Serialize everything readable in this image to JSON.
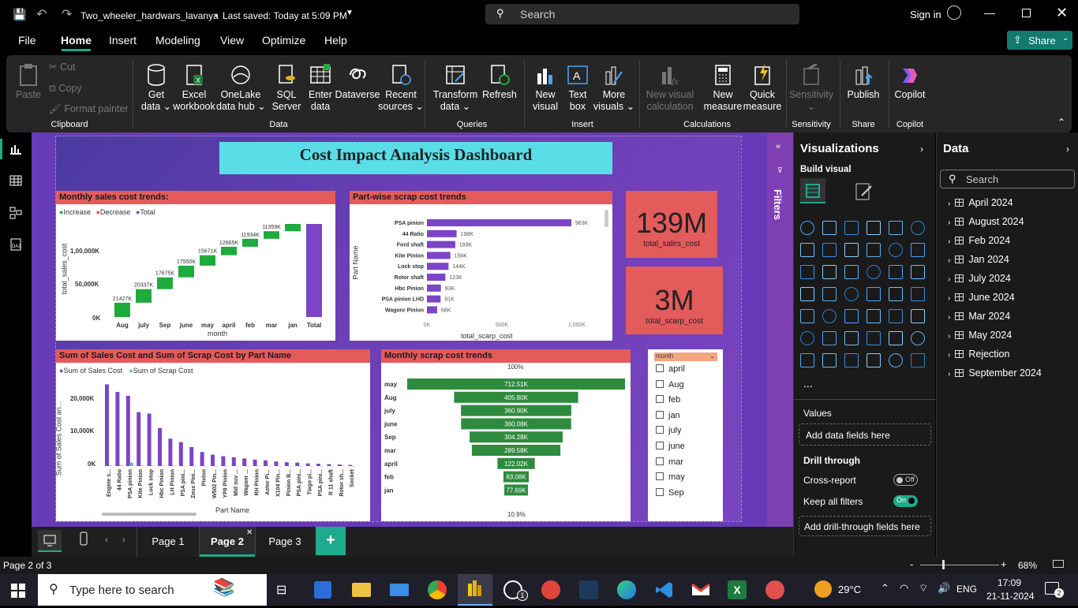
{
  "titlebar": {
    "filename": "Two_wheeler_hardwars_lavanya",
    "saved": "Last saved: Today at 5:09 PM",
    "search": "Search",
    "signin": "Sign in"
  },
  "menu": {
    "items": [
      "File",
      "Home",
      "Insert",
      "Modeling",
      "View",
      "Optimize",
      "Help"
    ],
    "active": "Home",
    "share": "Share"
  },
  "ribbon": {
    "clipboard": {
      "paste": "Paste",
      "cut": "Cut",
      "copy": "Copy",
      "format_painter": "Format painter",
      "group": "Clipboard"
    },
    "data": {
      "items": [
        "Get\ndata ⌄",
        "Excel\nworkbook",
        "OneLake\ndata hub ⌄",
        "SQL\nServer",
        "Enter\ndata",
        "Dataverse",
        "Recent\nsources ⌄"
      ],
      "group": "Data"
    },
    "queries": {
      "items": [
        "Transform\ndata ⌄",
        "Refresh"
      ],
      "group": "Queries"
    },
    "insert": {
      "items": [
        "New\nvisual",
        "Text\nbox",
        "More\nvisuals ⌄"
      ],
      "group": "Insert"
    },
    "calculations": {
      "items": [
        "New visual\ncalculation",
        "New\nmeasure",
        "Quick\nmeasure"
      ],
      "group": "Calculations"
    },
    "sensitivity": {
      "items": [
        "Sensitivity\n⌄"
      ],
      "group": "Sensitivity"
    },
    "share": {
      "items": [
        "Publish"
      ],
      "group": "Share"
    },
    "copilot": {
      "items": [
        "Copilot"
      ],
      "group": "Copilot"
    }
  },
  "report": {
    "title": "Cost Impact Analysis Dashboard"
  },
  "waterfall": {
    "title": "Monthly sales cost trends:",
    "legend": [
      "Increase",
      "Decrease",
      "Total"
    ],
    "ylabel": "total_sales_cost",
    "xlabel": "month",
    "yticks": [
      "0K",
      "50,000K",
      "1,00,000K"
    ],
    "colors": {
      "increase": "#1eaa3c",
      "decrease": "#e35b5b",
      "total": "#7b45c6"
    }
  },
  "scrapbars": {
    "title": "Part-wise scrap cost trends",
    "ylabel": "Part Name",
    "xlabel": "total_scarp_cost",
    "xticks": [
      "0K",
      "500K",
      "1,000K"
    ],
    "color": "#7b45c6"
  },
  "kpi": {
    "sales_value": "139M",
    "sales_label": "total_sales_cost",
    "scrap_value": "3M",
    "scrap_label": "total_scarp_cost",
    "color": "#e35b5b"
  },
  "clustered": {
    "title": "Sum of Sales Cost and Sum of Scrap Cost by Part Name",
    "legend": [
      "Sum of Sales Cost",
      "Sum of Scrap Cost"
    ],
    "ylabel": "Sum of Sales Cost an...",
    "xlabel": "Part Name",
    "yticks": [
      "0K",
      "10,000K",
      "20,000K"
    ],
    "colors": {
      "sales": "#7b45c6",
      "scrap": "#5bc0de"
    }
  },
  "funnel": {
    "title": "Monthly scrap cost trends",
    "top_pct": "100%",
    "bottom_pct": "10.9%",
    "color": "#2e8b3e"
  },
  "slicer": {
    "title": "month",
    "items": [
      "april",
      "Aug",
      "feb",
      "jan",
      "july",
      "june",
      "mar",
      "may",
      "Sep"
    ]
  },
  "filters": {
    "label": "Filters"
  },
  "viz": {
    "title": "Visualizations",
    "build": "Build visual",
    "values": "Values",
    "add_data": "Add data fields here",
    "drill": "Drill through",
    "cross": "Cross-report",
    "cross_state": "Off",
    "keep": "Keep all filters",
    "keep_state": "On",
    "add_drill": "Add drill-through fields here",
    "more": "..."
  },
  "data": {
    "title": "Data",
    "search": "Search",
    "tables": [
      "April 2024",
      "August 2024",
      "Feb 2024",
      "Jan 2024",
      "July 2024",
      "June 2024",
      "Mar 2024",
      "May 2024",
      "Rejection",
      "September 2024"
    ]
  },
  "pages": {
    "tabs": [
      "Page 1",
      "Page 2",
      "Page 3"
    ],
    "active": "Page 2",
    "add": "+"
  },
  "status": {
    "page": "Page 2 of 3",
    "zoom": "68%"
  },
  "taskbar": {
    "search": "Type here to search",
    "temp": "29°C",
    "lang": "ENG",
    "time": "17:09",
    "date": "21-11-2024",
    "notif": "2",
    "badge": "1"
  },
  "chart_data": [
    {
      "type": "waterfall",
      "title": "Monthly sales cost trends:",
      "xlabel": "month",
      "ylabel": "total_sales_cost",
      "categories": [
        "Aug",
        "july",
        "Sep",
        "june",
        "may",
        "april",
        "feb",
        "mar",
        "jan",
        "Total"
      ],
      "values": [
        21427,
        20337,
        17675,
        17550,
        15671,
        12665,
        11934,
        11359,
        10866,
        139484
      ],
      "labels": [
        "21427K",
        "20337K",
        "17675K",
        "17550K",
        "15671K",
        "12665K",
        "11934K",
        "11359K",
        "",
        ""
      ]
    },
    {
      "type": "bar",
      "orientation": "horizontal",
      "title": "Part-wise scrap cost trends",
      "xlabel": "total_scarp_cost",
      "ylabel": "Part Name",
      "categories": [
        "PSA pinion",
        "44 Ratio",
        "Ford shaft",
        "Kite Pinion",
        "Lock stop",
        "Rotor shaft",
        "Hbc Pinion",
        "PSA pinion LHD",
        "Wagonr Pinion"
      ],
      "values": [
        963,
        198,
        189,
        156,
        144,
        123,
        93,
        91,
        68
      ],
      "labels": [
        "963K",
        "198K",
        "189K",
        "156K",
        "144K",
        "123K",
        "93K",
        "91K",
        "68K"
      ],
      "xlim": [
        0,
        1000
      ]
    },
    {
      "type": "bar",
      "title": "Sum of Sales Cost and Sum of Scrap Cost by Part Name",
      "xlabel": "Part Name",
      "ylabel": "Sum of Sales Cost an...",
      "categories": [
        "Engine s...",
        "44 Ratio",
        "PSA pinion",
        "Kite Pinion",
        "Lock stop",
        "Hbc Pinion",
        "LH Pinion",
        "PSA pini...",
        "Zeus Pini...",
        "Piston",
        "W502 Pin...",
        "YP8 Pinion",
        "Mid suv ...",
        "Wagonr ...",
        "RH Pinion",
        "Astor Pi...",
        "X104 Pin...",
        "Pinion B...",
        "PSA pini...",
        "Tiago pi...",
        "PSA pini...",
        "R 11 shaft",
        "Rotor sh...",
        "Socket"
      ],
      "series": [
        {
          "name": "Sum of Sales Cost",
          "values": [
            21500,
            19500,
            18500,
            14200,
            13800,
            10000,
            7200,
            6300,
            5000,
            3700,
            3000,
            2600,
            2300,
            2000,
            1700,
            1500,
            1200,
            1000,
            900,
            700,
            600,
            500,
            400,
            300
          ]
        },
        {
          "name": "Sum of Scrap Cost",
          "values": [
            150,
            180,
            900,
            120,
            110,
            80,
            60,
            50,
            40,
            30,
            30,
            20,
            20,
            60,
            20,
            20,
            10,
            10,
            10,
            10,
            10,
            10,
            90,
            10
          ]
        }
      ],
      "ylim": [
        0,
        22000
      ]
    },
    {
      "type": "funnel",
      "title": "Monthly scrap cost trends",
      "categories": [
        "may",
        "Aug",
        "july",
        "june",
        "Sep",
        "mar",
        "april",
        "feb",
        "jan"
      ],
      "values": [
        712.51,
        405.8,
        360.9,
        360.08,
        304.28,
        289.58,
        122.02,
        83.08,
        77.69
      ],
      "labels": [
        "712.51K",
        "405.80K",
        "360.90K",
        "360.08K",
        "304.28K",
        "289.58K",
        "122.02K",
        "83.08K",
        "77.69K"
      ]
    }
  ]
}
